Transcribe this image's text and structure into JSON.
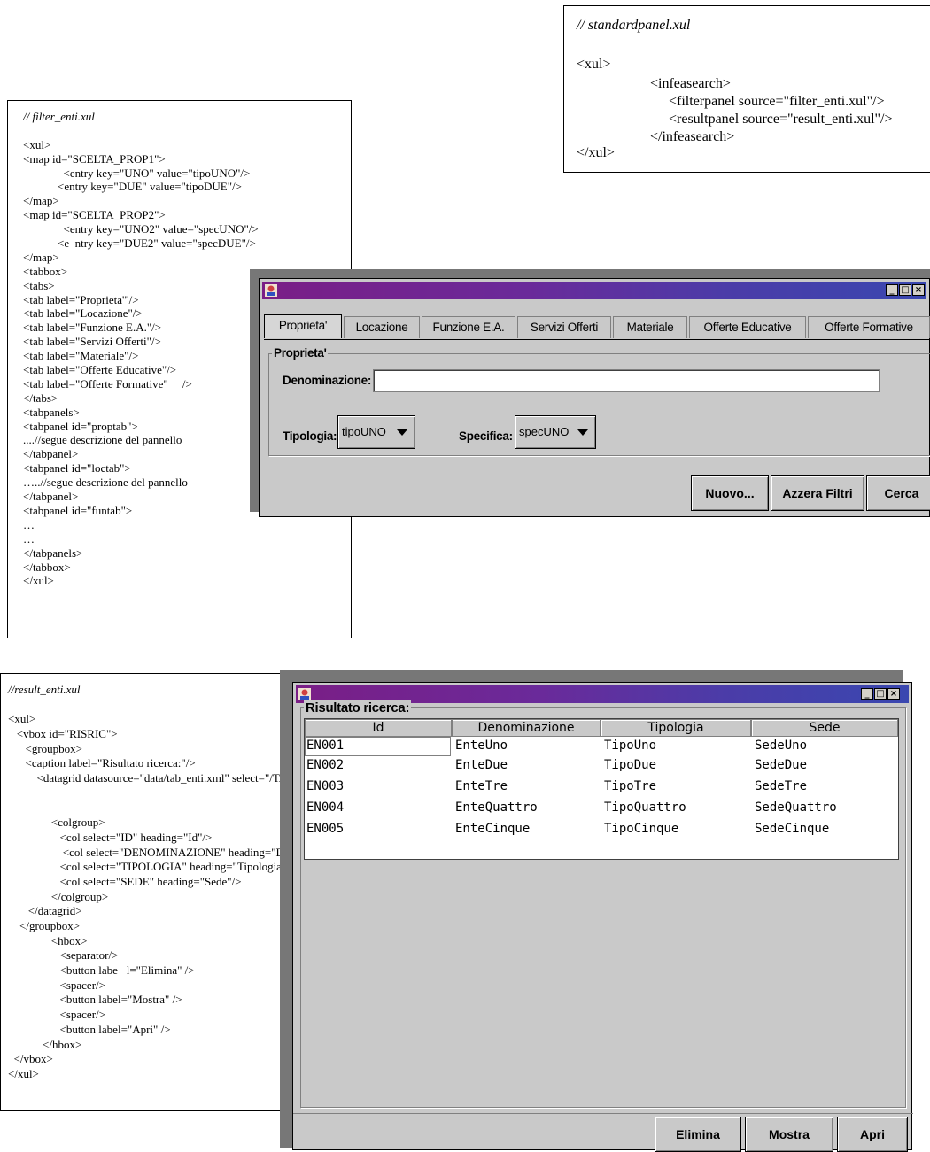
{
  "standardpanel": {
    "lines": [
      "// standardpanel.xul",
      "<xul>",
      "<infeasearch>",
      "<filterpanel source=\"filter_enti.xul\"/>",
      "<resultpanel source=\"result_enti.xul\"/>",
      "</infeasearch>",
      "</xul>"
    ]
  },
  "filter_code": {
    "lines": [
      "// filter_enti.xul",
      "",
      "<xul>",
      "<map id=\"SCELTA_PROP1\">",
      "              <entry key=\"UNO\" value=\"tipoUNO\"/>",
      "            <entry key=\"DUE\" value=\"tipoDUE\"/>",
      "</map>",
      "<map id=\"SCELTA_PROP2\">",
      "              <entry key=\"UNO2\" value=\"specUNO\"/>",
      "            <e  ntry key=\"DUE2\" value=\"specDUE\"/>",
      "</map>",
      "<tabbox>",
      "<tabs>",
      "<tab label=\"Proprieta'\"/>",
      "<tab label=\"Locazione\"/>",
      "<tab label=\"Funzione E.A.\"/>",
      "<tab label=\"Servizi Offerti\"/>",
      "<tab label=\"Materiale\"/>",
      "<tab label=\"Offerte Educative\"/>",
      "<tab label=\"Offerte Formative\"     />",
      "</tabs>",
      "<tabpanels>",
      "<tabpanel id=\"proptab\">",
      "....//segue descrizione del pannello",
      "</tabpanel>",
      "<tabpanel id=\"loctab\">",
      "…..//segue descrizione del pannello",
      "</tabpanel>",
      "<tabpanel id=\"funtab\">",
      "…",
      "…",
      "</tabpanels>",
      "</tabbox>",
      "</xul>"
    ]
  },
  "result_code": {
    "lines": [
      "//result_enti.xul",
      "",
      "<xul>",
      "   <vbox id=\"RISRIC\">",
      "      <groupbox>",
      "      <caption label=\"Risultato ricerca:\"/>",
      "          <datagrid datasource=\"data/tab_enti.xml\" select=\"/TAB_ENTI/ENTE\">",
      "",
      "",
      "               <colgroup>",
      "                  <col select=\"ID\" heading=\"Id\"/>",
      "                   <col select=\"DENOMINAZIONE\" heading=\"Denominazione\"/>",
      "                  <col select=\"TIPOLOGIA\" heading=\"Tipologia\"/>",
      "                  <col select=\"SEDE\" heading=\"Sede\"/>",
      "               </colgroup>",
      "       </datagrid>",
      "    </groupbox>",
      "               <hbox>",
      "                  <separator/>",
      "                  <button labe   l=\"Elimina\" />",
      "                  <spacer/>",
      "                  <button label=\"Mostra\" />",
      "                  <spacer/>",
      "                  <button label=\"Apri\" />",
      "            </hbox>",
      "  </vbox>",
      "</xul>"
    ]
  },
  "filter_window": {
    "window_buttons": [
      "_",
      "□",
      "×"
    ],
    "tabs": [
      "Proprieta'",
      "Locazione",
      "Funzione E.A.",
      "Servizi Offerti",
      "Materiale",
      "Offerte Educative",
      "Offerte Formative"
    ],
    "group_title": "Proprieta'",
    "denominazione_label": "Denominazione:",
    "denominazione_value": "",
    "tipologia_label": "Tipologia:",
    "tipologia_value": "tipoUNO",
    "specifica_label": "Specifica:",
    "specifica_value": "specUNO",
    "buttons": [
      "Nuovo...",
      "Azzera Filtri",
      "Cerca"
    ]
  },
  "result_window": {
    "window_buttons": [
      "_",
      "□",
      "×"
    ],
    "group_title": "Risultato ricerca:",
    "columns": [
      "Id",
      "Denominazione",
      "Tipologia",
      "Sede"
    ],
    "rows": [
      [
        "EN001",
        "EnteUno",
        "TipoUno",
        "SedeUno"
      ],
      [
        "EN002",
        "EnteDue",
        "TipoDue",
        "SedeDue"
      ],
      [
        "EN003",
        "EnteTre",
        "TipoTre",
        "SedeTre"
      ],
      [
        "EN004",
        "EnteQuattro",
        "TipoQuattro",
        "SedeQuattro"
      ],
      [
        "EN005",
        "EnteCinque",
        "TipoCinque",
        "SedeCinque"
      ]
    ],
    "buttons": [
      "Elimina",
      "Mostra",
      "Apri"
    ]
  },
  "colors": {
    "titlebar_start": "#7a1e86",
    "titlebar_end": "#3a47b0",
    "window_bg": "#c9c9c9"
  }
}
